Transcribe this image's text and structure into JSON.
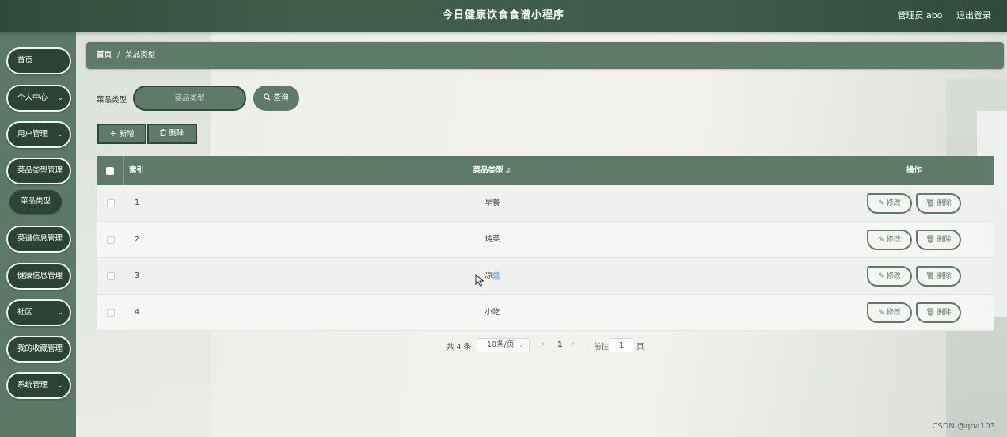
{
  "header": {
    "title": "今日健康饮食食谱小程序",
    "user": "管理员 abo",
    "logout": "退出登录"
  },
  "sidebar": {
    "items": [
      {
        "label": "首页"
      },
      {
        "label": "个人中心"
      },
      {
        "label": "用户管理"
      },
      {
        "label": "菜品类型管理"
      },
      {
        "label": "菜谱信息管理"
      },
      {
        "label": "健康信息管理"
      },
      {
        "label": "社区"
      },
      {
        "label": "我的收藏管理"
      },
      {
        "label": "系统管理"
      }
    ],
    "active_sub": "菜品类型"
  },
  "breadcrumb": {
    "home": "首页",
    "sep": "/",
    "current": "菜品类型"
  },
  "search": {
    "label": "菜品类型",
    "placeholder": "菜品类型",
    "button": "查询"
  },
  "actions": {
    "add": "新增",
    "delete": "删除"
  },
  "table": {
    "headers": {
      "index": "索引",
      "type": "菜品类型",
      "ops": "操作"
    },
    "rows": [
      {
        "index": "1",
        "type": "早餐"
      },
      {
        "index": "2",
        "type": "炖菜"
      },
      {
        "index": "3",
        "type_a": "凉",
        "type_b": "菜"
      },
      {
        "index": "4",
        "type": "小吃"
      }
    ],
    "edit_label": "修改",
    "remove_label": "删除"
  },
  "pagination": {
    "total": "共 4 条",
    "page_size": "10条/页",
    "current": "1",
    "goto_label": "前往",
    "goto_value": "1",
    "page_label": "页"
  },
  "watermark": "CSDN @qha103",
  "colors": {
    "header_bg": "#3e5c4b",
    "sidebar_bg": "#5c7968",
    "nav_item_bg": "#2c4436",
    "accent": "#5e7a69"
  }
}
